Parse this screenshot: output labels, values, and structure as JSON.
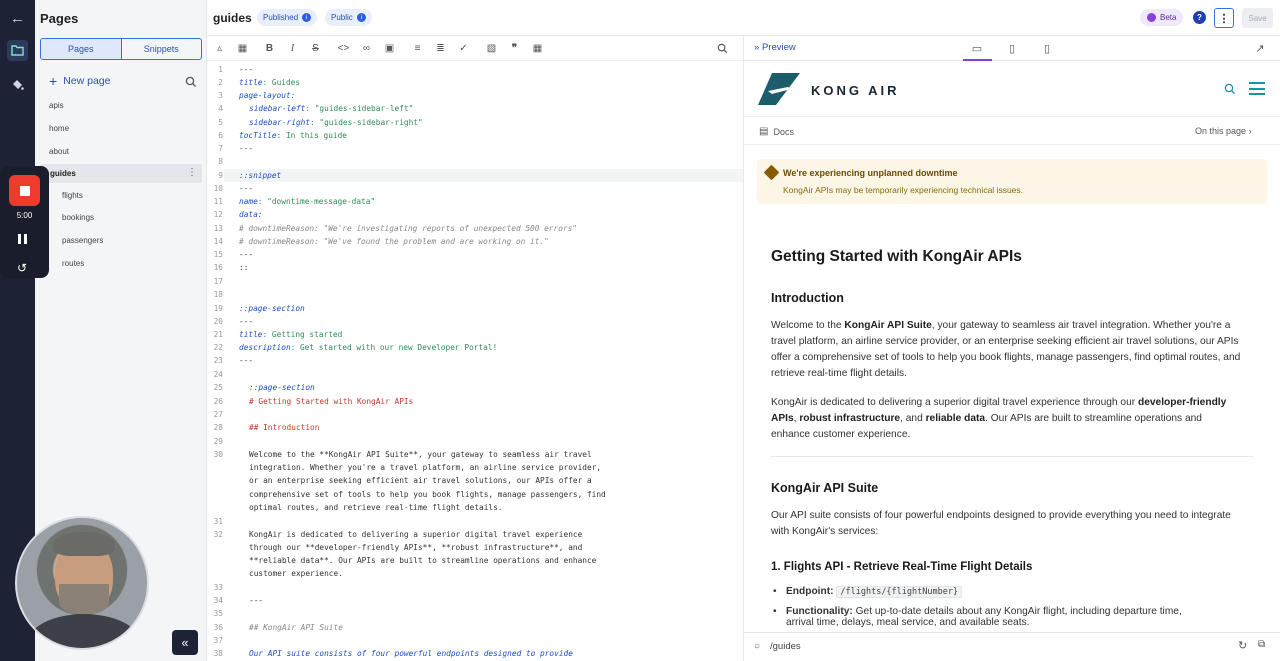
{
  "sidebar": {
    "title": "Pages",
    "tabs": [
      "Pages",
      "Snippets"
    ],
    "new_page": "New page",
    "items": [
      "apis",
      "home",
      "about",
      "guides"
    ],
    "sub_items": [
      "flights",
      "bookings",
      "passengers",
      "routes"
    ]
  },
  "recorder": {
    "time": "5:00"
  },
  "topbar": {
    "doc_title": "guides",
    "published": "Published",
    "public": "Public",
    "beta": "Beta",
    "save": "Save"
  },
  "editor": {
    "line_numbers": [
      "1",
      "2",
      "3",
      "4",
      "5",
      "6",
      "7",
      "8",
      "9",
      "10",
      "11",
      "12",
      "13",
      "14",
      "15",
      "16",
      "17",
      "18",
      "19",
      "20",
      "21",
      "22",
      "23",
      "24",
      "25",
      "26",
      "27",
      "28",
      "29",
      "30",
      "31",
      "32",
      "33",
      "34",
      "35",
      "36",
      "37",
      "38"
    ],
    "lines": {
      "l1": "---",
      "l2a": "title",
      "l2b": ": Guides",
      "l3": "page-layout:",
      "l4a": "sidebar-left",
      "l4b": ": \"guides-sidebar-left\"",
      "l5a": "sidebar-right",
      "l5b": ": \"guides-sidebar-right\"",
      "l6a": "tocTitle",
      "l6b": ": In this guide",
      "l7": "---",
      "l9": "::snippet",
      "l10": "---",
      "l11a": "name",
      "l11b": ": \"downtime-message-data\"",
      "l12": "data:",
      "l13": "# downtimeReason: \"We're investigating reports of unexpected 500 errors\"",
      "l14": "# downtimeReason: \"We've found the problem and are working on it.\"",
      "l15": "---",
      "l16": "::",
      "l19": "::page-section",
      "l20": "---",
      "l21a": "title",
      "l21b": ": Getting started",
      "l22a": "description",
      "l22b": ": Get started with our new Developer Portal!",
      "l23": "---",
      "l25": "::page-section",
      "l26": "# Getting Started with KongAir APIs",
      "l28": "## Introduction",
      "l30a": "Welcome to the **KongAir API Suite**, your gateway to seamless air travel",
      "l30b": "integration. Whether you're a travel platform, an airline service provider,",
      "l30c": "or an enterprise seeking efficient air travel solutions, our APIs offer a",
      "l30d": "comprehensive set of tools to help you book flights, manage passengers, find",
      "l30e": "optimal routes, and retrieve real-time flight details.",
      "l32a": "KongAir is dedicated to delivering a superior digital travel experience",
      "l32b": "through our **developer-friendly APIs**, **robust infrastructure**, and",
      "l32c": "**reliable data**. Our APIs are built to streamline operations and enhance",
      "l32d": "customer experience.",
      "l34": "---",
      "l36": "## KongAir API Suite",
      "l38": "Our API suite consists of four powerful endpoints designed to provide"
    }
  },
  "preview": {
    "label": "Preview",
    "brand": "KONG AIR",
    "docs": "Docs",
    "on_this_page": "On this page",
    "alert_title": "We're experiencing unplanned downtime",
    "alert_desc": "KongAir APIs may be temporarily experiencing technical issues.",
    "h1": "Getting Started with KongAir APIs",
    "h2_intro": "Introduction",
    "p1_a": "Welcome to the ",
    "p1_b": "KongAir API Suite",
    "p1_c": ", your gateway to seamless air travel integration. Whether you're a travel platform, an airline service provider, or an enterprise seeking efficient air travel solutions, our APIs offer a comprehensive set of tools to help you book flights, manage passengers, find optimal routes, and retrieve real-time flight details.",
    "p2_a": "KongAir is dedicated to delivering a superior digital travel experience through our ",
    "p2_b": "developer-friendly APIs",
    "p2_c": ", ",
    "p2_d": "robust infrastructure",
    "p2_e": ", and ",
    "p2_f": "reliable data",
    "p2_g": ". Our APIs are built to streamline operations and enhance customer experience.",
    "h2_suite": "KongAir API Suite",
    "p3": "Our API suite consists of four powerful endpoints designed to provide everything you need to integrate with KongAir's services:",
    "h3_num": "1.",
    "h3_a": "Flights API",
    "h3_b": " - Retrieve Real-Time Flight Details",
    "li1_label": "Endpoint:",
    "li1_code": "/flights/{flightNumber}",
    "li2_label": "Functionality:",
    "li2_text": " Get up-to-date details about any KongAir flight, including departure time,",
    "li2_cont": "arrival time, delays, meal service, and available seats.",
    "url": "/guides"
  }
}
